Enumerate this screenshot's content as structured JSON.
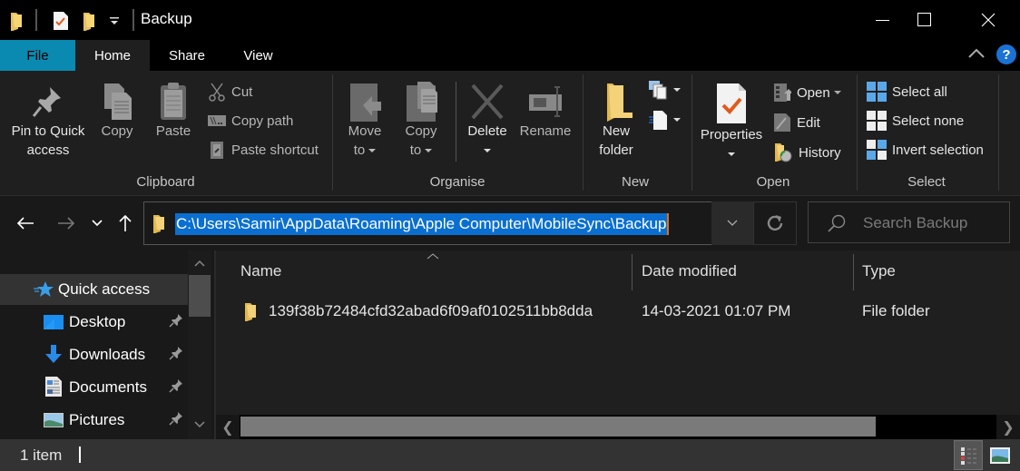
{
  "window": {
    "title": "Backup",
    "controls": [
      "minimize",
      "maximize",
      "close"
    ]
  },
  "quick_access_toolbar": {
    "icons": [
      "folder-icon",
      "properties-icon",
      "new-folder-icon",
      "customize-dropdown-icon"
    ]
  },
  "ribbon_tabs": [
    {
      "label": "File",
      "active": false
    },
    {
      "label": "Home",
      "active": true
    },
    {
      "label": "Share",
      "active": false
    },
    {
      "label": "View",
      "active": false
    }
  ],
  "ribbon": {
    "clipboard": {
      "label": "Clipboard",
      "pin": "Pin to Quick access",
      "pin_line1": "Pin to Quick",
      "pin_line2": "access",
      "copy": "Copy",
      "paste": "Paste",
      "cut": "Cut",
      "copy_path": "Copy path",
      "paste_shortcut": "Paste shortcut"
    },
    "organise": {
      "label": "Organise",
      "move_line1": "Move",
      "move_line2": "to",
      "copy_line1": "Copy",
      "copy_line2": "to",
      "delete": "Delete",
      "rename": "Rename"
    },
    "new": {
      "label": "New",
      "new_folder_line1": "New",
      "new_folder_line2": "folder"
    },
    "open": {
      "label": "Open",
      "properties": "Properties",
      "open": "Open",
      "edit": "Edit",
      "history": "History"
    },
    "select": {
      "label": "Select",
      "select_all": "Select all",
      "select_none": "Select none",
      "invert_selection": "Invert selection"
    }
  },
  "address_bar": {
    "path": "C:\\Users\\Samir\\AppData\\Roaming\\Apple Computer\\MobileSync\\Backup"
  },
  "search": {
    "placeholder": "Search Backup"
  },
  "nav_pane": {
    "items": [
      {
        "label": "Quick access",
        "icon": "star-icon",
        "selected": true,
        "pinned": false
      },
      {
        "label": "Desktop",
        "icon": "desktop-icon",
        "selected": false,
        "pinned": true
      },
      {
        "label": "Downloads",
        "icon": "download-icon",
        "selected": false,
        "pinned": true
      },
      {
        "label": "Documents",
        "icon": "documents-icon",
        "selected": false,
        "pinned": true
      },
      {
        "label": "Pictures",
        "icon": "pictures-icon",
        "selected": false,
        "pinned": true
      }
    ]
  },
  "file_list": {
    "columns": [
      "Name",
      "Date modified",
      "Type"
    ],
    "sort_column": "Name",
    "rows": [
      {
        "name": "139f38b72484cfd32abad6f09af0102511bb8dda",
        "date_modified": "14-03-2021 01:07 PM",
        "type": "File folder"
      }
    ]
  },
  "status_bar": {
    "item_count": "1 item",
    "views": [
      "details",
      "large-icons"
    ],
    "active_view": "details"
  },
  "colors": {
    "file_tab": "#0a8ab0",
    "selection": "#0a6fd0",
    "background": "#1f1f1f"
  }
}
